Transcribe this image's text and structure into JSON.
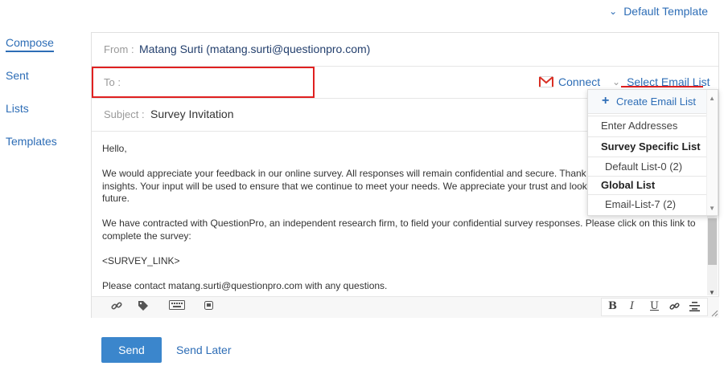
{
  "template_selector": {
    "label": "Default Template"
  },
  "nav": {
    "items": [
      {
        "label": "Compose"
      },
      {
        "label": "Sent"
      },
      {
        "label": "Lists"
      },
      {
        "label": "Templates"
      }
    ]
  },
  "from": {
    "label": "From :",
    "value": "Matang Surti (matang.surti@questionpro.com)"
  },
  "to": {
    "label": "To :"
  },
  "connect": {
    "label": "Connect"
  },
  "select_email_list": {
    "label": "Select Email List"
  },
  "subject": {
    "label": "Subject :",
    "value": "Survey Invitation"
  },
  "body": {
    "greeting": "Hello,",
    "paragraph1_line1": "We would appreciate your feedback in our online survey.  All responses will remain confidential and secure.  Thank you in",
    "paragraph1_line2": "insights.  Your input will be used to ensure that we continue to meet your needs. We appreciate your trust and look forwa",
    "paragraph1_line3": "future.",
    "paragraph2_line1": "We have contracted with QuestionPro, an independent research firm, to field your confidential survey responses.  Please click on this link to",
    "paragraph2_line2": "complete the survey:",
    "survey_link": "<SURVEY_LINK>",
    "contact": "Please contact matang.surti@questionpro.com with any questions."
  },
  "toolbar": {
    "icons": [
      "link-icon",
      "tags-icon",
      "keyboard-icon",
      "snippet-icon"
    ],
    "format": {
      "bold": "B",
      "italic": "I",
      "underline": "U"
    }
  },
  "dropdown": {
    "create_label": "Create Email List",
    "enter_addresses": "Enter Addresses",
    "survey_specific_header": "Survey Specific List",
    "survey_specific_item": "Default List-0 (2)",
    "global_header": "Global List",
    "global_item": "Email-List-7 (2)"
  },
  "actions": {
    "send": "Send",
    "send_later": "Send Later"
  },
  "colors": {
    "accent": "#2d6db6",
    "highlight": "#e02020",
    "send_bg": "#3b86cc"
  }
}
